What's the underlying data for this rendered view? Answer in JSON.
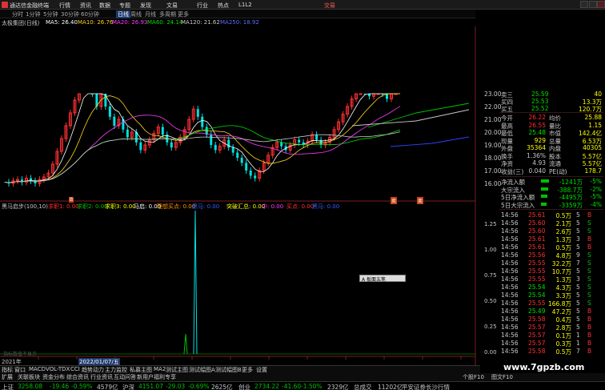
{
  "menubar": {
    "app_title": "通达信金融终端",
    "items": [
      "行情",
      "资讯",
      "数据",
      "专题",
      "发现",
      "文易",
      "行业",
      "热点",
      "L1L2"
    ],
    "trade": "交易"
  },
  "periodbar": {
    "items": [
      "分时",
      "1分钟",
      "5分钟",
      "30分钟",
      "60分钟",
      "日线",
      "周线",
      "月线",
      "多周期",
      "更多"
    ],
    "active": "日线"
  },
  "ma_line": {
    "name": "太极集团(日线)",
    "items": [
      {
        "text": "MA5: 26.40",
        "color": "#ffffff"
      },
      {
        "text": "MA10: 26.76",
        "color": "#ffd21e"
      },
      {
        "text": "MA20: 26.93",
        "color": "#ff3cff"
      },
      {
        "text": "MA60: 24.14",
        "color": "#00e000"
      },
      {
        "text": "MA120: 21.62",
        "color": "#c8c8c8"
      },
      {
        "text": "MA250: 18.92",
        "color": "#5a6cff"
      }
    ]
  },
  "price_axis": [
    "23.00",
    "22.00",
    "21.00",
    "20.00",
    "19.00",
    "18.00",
    "17.00",
    "16.00"
  ],
  "chart_badges": [
    "B",
    "卖",
    "卖"
  ],
  "indicator": {
    "name": "黑马启步(100,10)",
    "items": [
      {
        "text": "求职1: 0.00",
        "color": "#ff3030"
      },
      {
        "text": "求职2: 0.00",
        "color": "#00c000"
      },
      {
        "text": "求职3: 0.00",
        "color": "#ffff00"
      },
      {
        "text": "马启: 0.00",
        "color": "#ffffff"
      },
      {
        "text": "理想买点: 0.00",
        "color": "#ff9900"
      },
      {
        "text": "黑马: 0.00",
        "color": "#3060ff"
      },
      {
        "text": "突破: 0.00",
        "color": "#00e0e0"
      },
      {
        "text": "突破汇总: 0.00",
        "color": "#ffff00"
      },
      {
        "text": "中: 0.00",
        "color": "#ff3cff"
      },
      {
        "text": "买点: 0.00",
        "color": "#ff3030"
      },
      {
        "text": "黑马: 0.00",
        "color": "#3060ff"
      }
    ],
    "popup": "A 板面五笔",
    "bottom_label": "指标数值不显示"
  },
  "date_axis": {
    "year": "2021年",
    "date": "2022/01/07/五"
  },
  "quote": {
    "book": [
      {
        "label": "卖三",
        "price": "25.59",
        "vol": "40"
      },
      {
        "label": "买四",
        "price": "25.53",
        "vol": "13.3万"
      },
      {
        "label": "买五",
        "price": "25.52",
        "vol": "120.7万"
      }
    ],
    "stats": [
      {
        "l1": "今开",
        "v1": "26.22",
        "l2": "均价",
        "v2": "25.88"
      },
      {
        "l1": "最高",
        "v1": "26.55",
        "l2": "量比",
        "v2": "1.15"
      },
      {
        "l1": "最低",
        "v1": "25.48",
        "l2": "市值",
        "v2": "142.4亿"
      },
      {
        "l1": "现量",
        "v1": "929",
        "l2": "总量",
        "v2": "6.53万"
      },
      {
        "l1": "外盘",
        "v1": "35364",
        "l2": "内盘",
        "v2": "40305"
      },
      {
        "l1": "换手",
        "v1": "1.36%",
        "l2": "股本",
        "v2": "5.57亿"
      },
      {
        "l1": "净资",
        "v1": "4.93",
        "l2": "流通",
        "v2": "5.57亿"
      },
      {
        "l1": "收益(三)",
        "v1": "0.040",
        "l2": "PE(动)",
        "v2": "178.7"
      }
    ],
    "flows": [
      {
        "label": "净流入额",
        "value": "-1241万",
        "pct": "-5%"
      },
      {
        "label": "大宗流入",
        "value": "-388.7万",
        "pct": "-2%"
      },
      {
        "label": "5日净流入额",
        "value": "-4495万",
        "pct": "-5%"
      },
      {
        "label": "5日大宗流入",
        "value": "-3359万",
        "pct": "-4%"
      }
    ],
    "ticks": [
      {
        "t": "14:56",
        "p": "25.61",
        "v": "0.5万",
        "c": "5",
        "s": "B"
      },
      {
        "t": "14:56",
        "p": "25.60",
        "v": "2.1万",
        "c": "5",
        "s": "S"
      },
      {
        "t": "14:56",
        "p": "25.60",
        "v": "2.6万",
        "c": "5",
        "s": "S"
      },
      {
        "t": "14:56",
        "p": "25.61",
        "v": "1.3万",
        "c": "3",
        "s": "B"
      },
      {
        "t": "14:56",
        "p": "25.61",
        "v": "0.5万",
        "c": "5",
        "s": "B"
      },
      {
        "t": "14:56",
        "p": "25.56",
        "v": "4.8万",
        "c": "9",
        "s": "S"
      },
      {
        "t": "14:56",
        "p": "25.55",
        "v": "32.2万",
        "c": "7",
        "s": "S"
      },
      {
        "t": "14:56",
        "p": "25.55",
        "v": "10.7万",
        "c": "5",
        "s": "S"
      },
      {
        "t": "14:56",
        "p": "25.55",
        "v": "1.3万",
        "c": "3",
        "s": "S"
      },
      {
        "t": "14:56",
        "p": "25.54",
        "v": "4.3万",
        "c": "5",
        "s": "S"
      },
      {
        "t": "14:56",
        "p": "25.54",
        "v": "3.3万",
        "c": "5",
        "s": "S"
      },
      {
        "t": "14:56",
        "p": "25.55",
        "v": "166.8万",
        "c": "5",
        "s": "S"
      },
      {
        "t": "14:56",
        "p": "25.49",
        "v": "47.2万",
        "c": "5",
        "s": "B"
      },
      {
        "t": "14:56",
        "p": "25.58",
        "v": "0.4万",
        "c": "5",
        "s": "B"
      },
      {
        "t": "14:56",
        "p": "25.57",
        "v": "2.8万",
        "c": "5",
        "s": "B"
      },
      {
        "t": "14:56",
        "p": "25.57",
        "v": "0.1万",
        "c": "1",
        "s": "B"
      },
      {
        "t": "14:56",
        "p": "25.57",
        "v": "0.3万",
        "c": "1",
        "s": "B"
      },
      {
        "t": "14:56",
        "p": "25.58",
        "v": "0.5万",
        "c": "7",
        "s": "B"
      }
    ],
    "tick_axis": [
      "1.25",
      "1.00",
      "0.75",
      "0.50",
      "0.25",
      "0.00"
    ]
  },
  "tabs": [
    "指标",
    "窗口",
    "MACD",
    "VOL-TDX",
    "CCI",
    "趋势动力",
    "主力监控",
    "私募主图",
    "MA2",
    "测试主图",
    "测试幅图A",
    "测试幅图B",
    "更多",
    "设置"
  ],
  "tabs2": [
    "扩展",
    "关联板块",
    "资金分布",
    "综合资讯",
    "行业资讯",
    "互动问答",
    "新用户福利专享"
  ],
  "tabs2_right": [
    "个股F10",
    "图文F10"
  ],
  "status": {
    "items": [
      {
        "text": "上证",
        "color": "#c8c8c8"
      },
      {
        "text": "3258.08",
        "color": "#00c000"
      },
      {
        "text": "-19.46",
        "color": "#00c000"
      },
      {
        "text": "-0.59%",
        "color": "#00c000"
      },
      {
        "text": "4579亿",
        "color": "#c8c8c8"
      },
      {
        "text": "沪深",
        "color": "#c8c8c8"
      },
      {
        "text": "4151.07",
        "color": "#00c000"
      },
      {
        "text": "-29.03",
        "color": "#00c000"
      },
      {
        "text": "-0.69%",
        "color": "#00c000"
      },
      {
        "text": "2625亿",
        "color": "#c8c8c8"
      },
      {
        "text": "创业",
        "color": "#c8c8c8"
      },
      {
        "text": "2734.22",
        "color": "#00c000"
      },
      {
        "text": "-41.60",
        "color": "#00c000"
      },
      {
        "text": "-1.50%",
        "color": "#00c000"
      },
      {
        "text": "2329亿",
        "color": "#c8c8c8"
      },
      {
        "text": "总成交",
        "color": "#c8c8c8"
      },
      {
        "text": "11202亿",
        "color": "#c8c8c8"
      },
      {
        "text": "平安证券长沙行情",
        "color": "#c8c8c8"
      }
    ]
  },
  "watermark": "www.7gpzb.com",
  "colors": {
    "up": "#ff3030",
    "down": "#00e0e0",
    "buy": "#ff3030",
    "sell": "#00c000"
  }
}
